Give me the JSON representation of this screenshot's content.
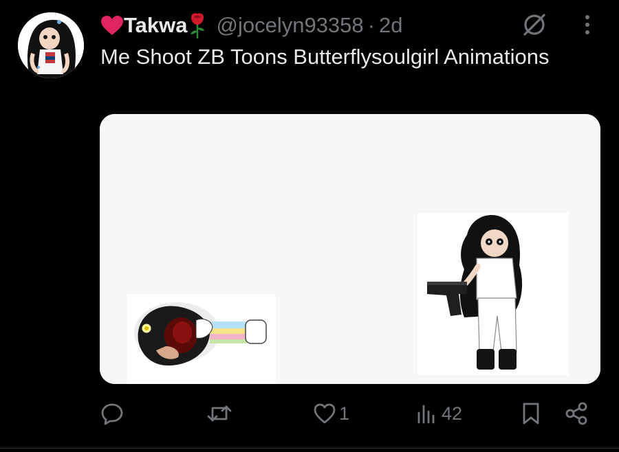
{
  "post": {
    "author": {
      "display_name": "Takwa",
      "handle": "@jocelyn93358",
      "heart_icon": "red-heart-emoji",
      "rose_icon": "rose-emoji"
    },
    "separator": "·",
    "time": "2d",
    "text": "Me Shoot ZB Toons Butterflysoulgirl Animations",
    "grok_icon": "grok-icon",
    "more_icon": "more-vertical-icon"
  },
  "actions": {
    "reply": {
      "icon": "reply-icon",
      "count": ""
    },
    "repost": {
      "icon": "repost-icon",
      "count": ""
    },
    "like": {
      "icon": "heart-icon",
      "count": "1"
    },
    "views": {
      "icon": "views-icon",
      "count": "42"
    },
    "bookmark": {
      "icon": "bookmark-icon"
    },
    "share": {
      "icon": "share-icon"
    }
  },
  "colors": {
    "background": "#000000",
    "text_primary": "#e7e9ea",
    "text_secondary": "#71767b",
    "heart": "#e0245e",
    "media_background": "#f7f7f7"
  }
}
